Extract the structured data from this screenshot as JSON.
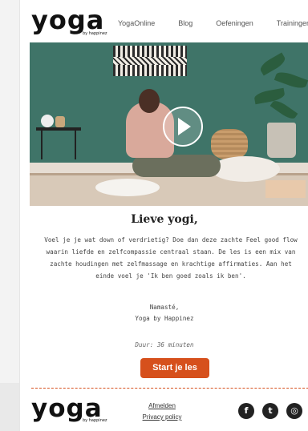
{
  "header": {
    "logo_text": "yoga",
    "logo_sub": "by happinez",
    "nav": [
      "YogaOnline",
      "Blog",
      "Oefeningen",
      "Trainingen"
    ]
  },
  "hero": {
    "play_label": "play-icon"
  },
  "content": {
    "greeting": "Lieve yogi,",
    "body_lines": [
      "Voel je je wat down of verdrietig? Doe dan deze zachte Feel good flow",
      "waarin liefde en zelfcompassie centraal staan. De les is een mix van",
      "zachte houdingen met zelfmassage en krachtige affirmaties. Aan het",
      "einde voel je 'Ik ben goed zoals ik ben'."
    ],
    "closing_1": "Namasté,",
    "closing_2": "Yoga by Happinez",
    "duration": "Duur: 36 minuten",
    "cta": "Start je les"
  },
  "footer": {
    "logo_text": "yoga",
    "logo_sub": "by happinez",
    "unsubscribe": "Afmelden",
    "privacy": "Privacy policy",
    "social": [
      {
        "icon": "facebook-icon",
        "glyph": "f"
      },
      {
        "icon": "twitter-icon",
        "glyph": "t"
      },
      {
        "icon": "instagram-icon",
        "glyph": "◎"
      }
    ]
  },
  "colors": {
    "accent": "#d6501c",
    "hero_wall": "#3f7468"
  }
}
